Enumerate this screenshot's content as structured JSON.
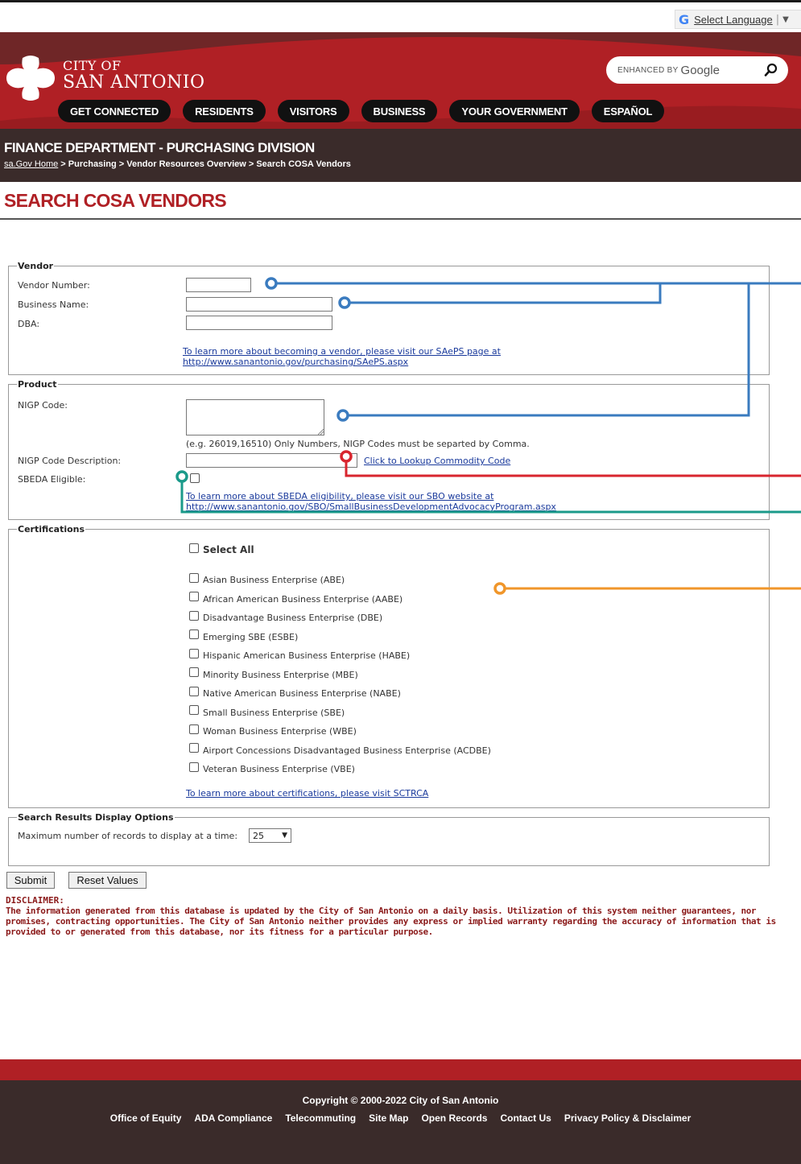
{
  "language": {
    "label": "Select Language",
    "separator": "|"
  },
  "logo": {
    "line1": "CITY OF",
    "line2": "SAN ANTONIO"
  },
  "search": {
    "enhanced": "ENHANCED BY",
    "brand": "Google"
  },
  "nav": [
    "GET CONNECTED",
    "RESIDENTS",
    "VISITORS",
    "BUSINESS",
    "YOUR GOVERNMENT",
    "ESPAÑOL"
  ],
  "department": {
    "title": "FINANCE DEPARTMENT - PURCHASING DIVISION",
    "breadcrumb": {
      "home": "sa.Gov Home",
      "rest": " > Purchasing > Vendor Resources Overview > Search COSA Vendors"
    }
  },
  "page_title": "SEARCH COSA VENDORS",
  "vendor": {
    "legend": "Vendor",
    "vendor_number_label": "Vendor Number:",
    "business_name_label": "Business Name:",
    "dba_label": "DBA:",
    "link_line1": "To learn more about becoming a vendor, please visit our SAePS page at",
    "link_line2": "http://www.sanantonio.gov/purchasing/SAePS.aspx"
  },
  "product": {
    "legend": "Product",
    "nigp_code_label": "NIGP Code:",
    "nigp_hint": "(e.g. 26019,16510) Only Numbers, NIGP Codes must be separted by Comma.",
    "nigp_desc_label": "NIGP Code Description:",
    "lookup_link": "Click to Lookup Commodity Code",
    "sbeda_label": "SBEDA Eligible:",
    "sbeda_link_line1": "To learn more about SBEDA eligibility, please visit our SBO website at",
    "sbeda_link_line2": "http://www.sanantonio.gov/SBO/SmallBusinessDevelopmentAdvocacyProgram.aspx"
  },
  "certifications": {
    "legend": "Certifications",
    "select_all": "Select All",
    "items": [
      "Asian Business Enterprise (ABE)",
      "African American Business Enterprise (AABE)",
      "Disadvantage Business Enterprise (DBE)",
      "Emerging SBE (ESBE)",
      "Hispanic American Business Enterprise (HABE)",
      "Minority Business Enterprise (MBE)",
      "Native American Business Enterprise (NABE)",
      "Small Business Enterprise (SBE)",
      "Woman Business Enterprise (WBE)",
      "Airport Concessions Disadvantaged Business Enterprise (ACDBE)",
      "Veteran Business Enterprise (VBE)"
    ],
    "link": "To learn more about certifications, please visit SCTRCA"
  },
  "display_options": {
    "legend": "Search Results Display Options",
    "max_records_label": "Maximum number of records to display at a time:",
    "max_records_value": "25"
  },
  "buttons": {
    "submit": "Submit",
    "reset": "Reset Values"
  },
  "disclaimer": {
    "heading": "DISCLAIMER:",
    "text": "The information generated from this database is updated by the City of San Antonio on a daily basis. Utilization of this system neither guarantees, nor promises, contracting opportunities. The City of San Antonio neither provides any express or implied warranty regarding the accuracy of information that is provided to or generated from this database, nor its fitness for a particular purpose."
  },
  "footer": {
    "copyright": "Copyright © 2000-2022 City of San Antonio",
    "links": [
      "Office of Equity",
      "ADA Compliance",
      "Telecommuting",
      "Site Map",
      "Open Records",
      "Contact Us",
      "Privacy Policy & Disclaimer"
    ]
  },
  "colors": {
    "brand_red": "#b02025",
    "dark_brown": "#3a2b2a",
    "callout_blue": "#3a7bbf",
    "callout_red": "#d8252e",
    "callout_teal": "#1a9a8a",
    "callout_orange": "#f0962a"
  }
}
